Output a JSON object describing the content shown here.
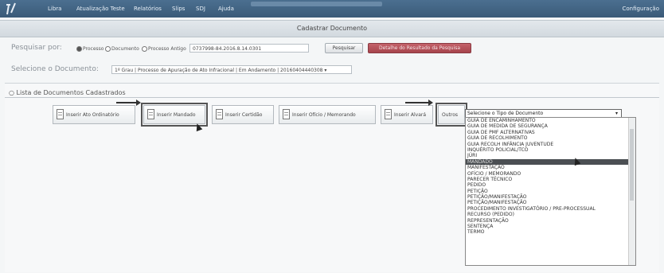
{
  "nav": {
    "items": [
      "Libra",
      "Atualização Teste",
      "Relatórios",
      "Slips",
      "SDJ",
      "Ajuda"
    ],
    "settings": "Configuração"
  },
  "title": "Cadastrar Documento",
  "search": {
    "label": "Pesquisar por:",
    "options": [
      "Processo",
      "Documento",
      "Processo Antigo"
    ],
    "selected_option": "Processo",
    "value": "0737998-84.2016.8.14.0301",
    "button": "Pesquisar",
    "details_button": "Detalhe do Resultado da Pesquisa"
  },
  "document": {
    "label": "Selecione o Documento:",
    "value": "1º Grau | Processo de Apuração de Ato Infracional | Em Andamento | 20160404440308"
  },
  "list": {
    "title": "Lista de Documentos Cadastrados",
    "buttons": [
      "Inserir Ato Ordinatório",
      "Inserir Mandado",
      "Inserir Certidão",
      "Inserir Ofício / Memorando",
      "Inserir Alvará"
    ],
    "others_label": "Outros",
    "type_select": "Selecione o Tipo de Documento",
    "options": [
      "GUIA DE ENCAMINHAMENTO",
      "GUIA DE MEDIDA DE SEGURANÇA",
      "GUIA DE PMF ALTERNATIVAS",
      "GUIA DE RECOLHIMENTO",
      "GUIA RECOLH INFÂNCIA JUVENTUDE",
      "INQUÉRITO POLICIAL/TCO",
      "JÚRI",
      "MANDADO",
      "MANIFESTAÇÃO",
      "OFÍCIO / MEMORANDO",
      "PARECER TÉCNICO",
      "PEDIDO",
      "PETIÇÃO",
      "PETIÇÃO/MANIFESTAÇÃO",
      "PETIÇÃO/MANIFESTAÇÃO",
      "PROCEDIMENTO INVESTIGATÓRIO / PRE-PROCESSUAL",
      "RECURSO (PEDIDO)",
      "REPRESENTAÇÃO",
      "SENTENÇA",
      "TERMO"
    ],
    "selected_option": "MANDADO"
  }
}
